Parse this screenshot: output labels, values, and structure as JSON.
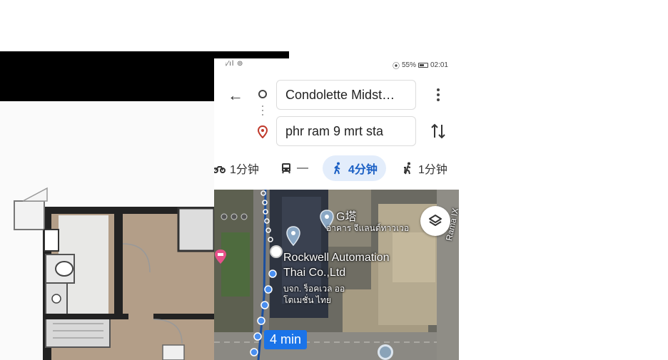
{
  "status_bar": {
    "left_icons": "ᵢ⁄ıl ⊚",
    "battery_percent": "55%",
    "time": "02:01"
  },
  "directions": {
    "origin_value": "Condolette Midst…",
    "destination_value": "phr ram 9 mrt sta"
  },
  "modes": [
    {
      "icon": "motorbike-icon",
      "label": "1分钟"
    },
    {
      "icon": "transit-icon",
      "label": "—"
    },
    {
      "icon": "walk-icon",
      "label": "4分钟",
      "active": true
    },
    {
      "icon": "rideshare-icon",
      "label": "1分钟"
    }
  ],
  "map": {
    "labels": {
      "g_tower": "G塔",
      "g_tower_thai": "อาคาร จีแลนด์ทาวเวอ",
      "rockwell_line1": "Rockwell Automation",
      "rockwell_line2": "Thai Co.,Ltd",
      "rockwell_thai1": "บจก. ร็อคเวล ออ",
      "rockwell_thai2": "โตเมชั่น ไทย",
      "rama": "Rama IX"
    },
    "duration_badge": "4 min"
  },
  "colors": {
    "accent": "#1a73e8",
    "active_mode_bg": "#e3edfb",
    "route_dot": "#4a8ff0"
  }
}
